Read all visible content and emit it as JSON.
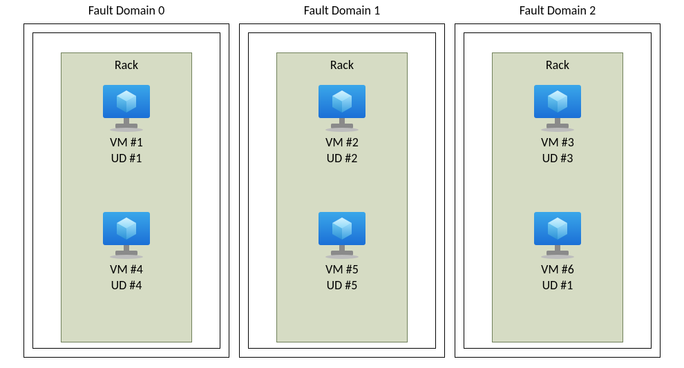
{
  "domains": [
    {
      "title": "Fault Domain 0",
      "rack_label": "Rack",
      "vms": [
        {
          "vm_label": "VM #1",
          "ud_label": "UD #1"
        },
        {
          "vm_label": "VM #4",
          "ud_label": "UD #4"
        }
      ]
    },
    {
      "title": "Fault Domain 1",
      "rack_label": "Rack",
      "vms": [
        {
          "vm_label": "VM #2",
          "ud_label": "UD #2"
        },
        {
          "vm_label": "VM #5",
          "ud_label": "UD #5"
        }
      ]
    },
    {
      "title": "Fault Domain 2",
      "rack_label": "Rack",
      "vms": [
        {
          "vm_label": "VM #3",
          "ud_label": "UD #3"
        },
        {
          "vm_label": "VM #6",
          "ud_label": "UD #1"
        }
      ]
    }
  ]
}
